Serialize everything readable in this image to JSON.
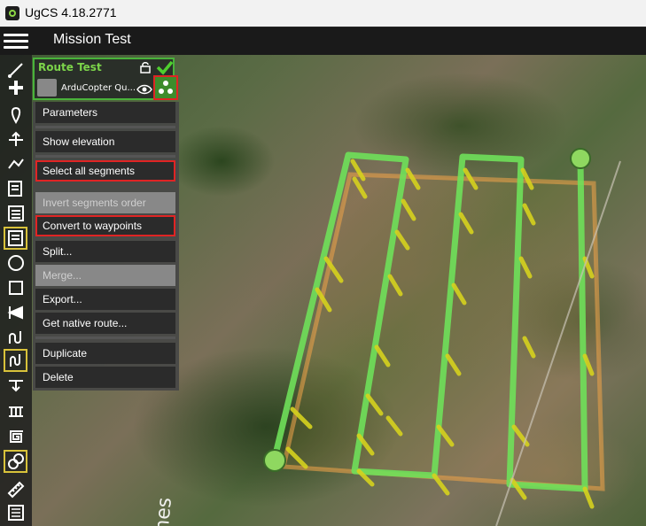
{
  "window": {
    "title": "UgCS 4.18.2771"
  },
  "header": {
    "mission_title": "Mission Test"
  },
  "route": {
    "name": "Route Test",
    "vehicle": "ArduCopter Qu..."
  },
  "menu": {
    "items": [
      {
        "label": "Parameters",
        "disabled": false
      },
      {
        "label": "Show elevation",
        "disabled": false
      },
      {
        "label": "Select all segments",
        "disabled": false,
        "highlighted": true
      },
      {
        "label": "Invert segments order",
        "disabled": true
      },
      {
        "label": "Convert to waypoints",
        "disabled": false,
        "highlighted": true
      },
      {
        "label": "Split...",
        "disabled": false
      },
      {
        "label": "Merge...",
        "disabled": true
      },
      {
        "label": "Export...",
        "disabled": false
      },
      {
        "label": "Get native route...",
        "disabled": false
      },
      {
        "label": "Duplicate",
        "disabled": false
      },
      {
        "label": "Delete",
        "disabled": false
      }
    ]
  },
  "map": {
    "road_label": "mes"
  },
  "colors": {
    "route_accent": "#7cd44a",
    "highlight_border": "#e02424",
    "selected_tool": "#d8c23a",
    "path": "#6fe05a",
    "area": "#e8a04a"
  },
  "toolbar_icons": [
    "route-icon",
    "waypoint-icon",
    "takeoff-icon",
    "polyline-icon",
    "area-scan-icon",
    "photogrammetry-icon",
    "survey-icon",
    "circle-icon",
    "rectangle-icon",
    "perimeter-icon",
    "corridor-icon",
    "spline-icon",
    "landing-icon",
    "facade-icon",
    "spiral-icon",
    "segments-icon",
    "ruler-icon",
    "map-layer-icon"
  ]
}
